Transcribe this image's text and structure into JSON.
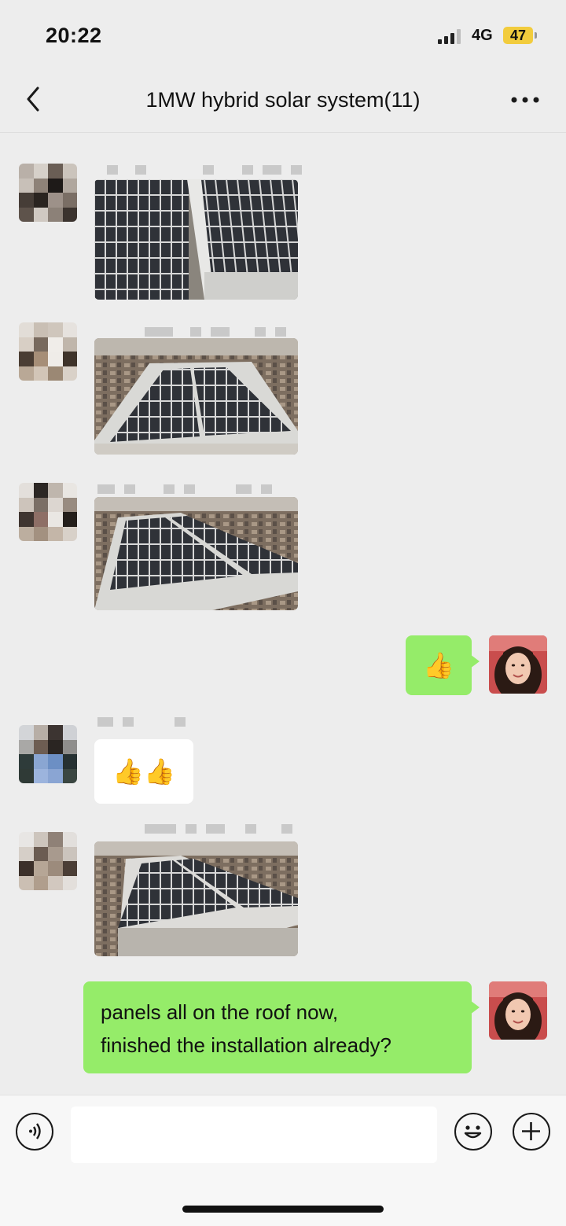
{
  "status_bar": {
    "time": "20:22",
    "network": "4G",
    "battery": "47"
  },
  "nav": {
    "title": "1MW hybrid solar system(11)",
    "back_icon": "chevron-left-icon",
    "more_icon": "more-dots-icon"
  },
  "messages": [
    {
      "side": "in",
      "type": "image",
      "content": "solar-roof-photo"
    },
    {
      "side": "in",
      "type": "image",
      "content": "solar-roof-photo"
    },
    {
      "side": "in",
      "type": "image",
      "content": "solar-roof-photo"
    },
    {
      "side": "out",
      "type": "emoji",
      "content": "👍"
    },
    {
      "side": "in",
      "type": "emoji",
      "content": "👍👍"
    },
    {
      "side": "in",
      "type": "image",
      "content": "solar-roof-photo"
    },
    {
      "side": "out",
      "type": "text",
      "line1": "panels all on the roof now,",
      "line2": "finished the installation already?"
    }
  ],
  "input_bar": {
    "voice_icon": "voice-icon",
    "emoji_icon": "emoji-icon",
    "plus_icon": "plus-icon"
  },
  "colors": {
    "background": "#ededed",
    "outgoing_bubble": "#95ec69",
    "incoming_bubble": "#ffffff",
    "battery": "#f2cc3d"
  }
}
